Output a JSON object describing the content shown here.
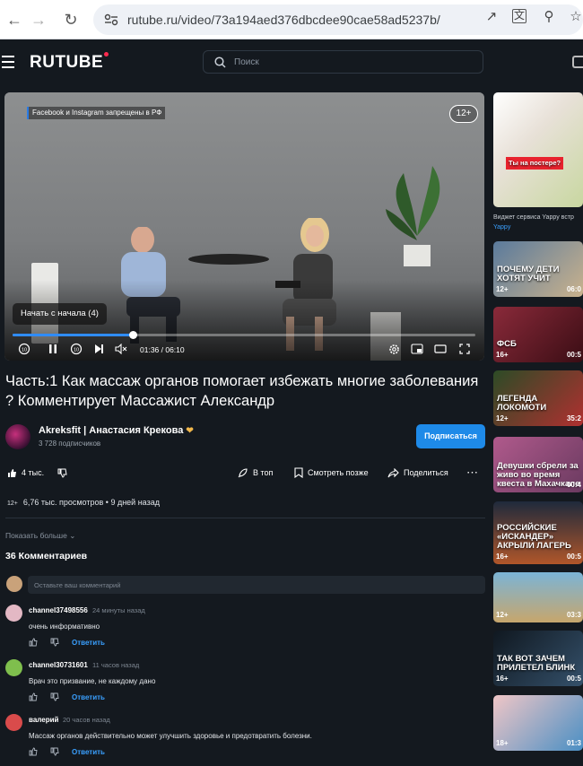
{
  "browser": {
    "url": "rutube.ru/video/73a194aed376dbcdee90cae58ad5237b/"
  },
  "header": {
    "logo": "RUTUBE",
    "search_placeholder": "Поиск"
  },
  "player": {
    "overlay_badge": "Facebook и Instagram запрещены в РФ",
    "age_rating": "12+",
    "resume_label": "Начать с начала (4)",
    "time_current": "01:36",
    "time_total": "06:10",
    "time_display": "01:36 / 06:10",
    "progress": 0.26,
    "skip_back_label": "10",
    "skip_forward_label": "10"
  },
  "video": {
    "title": "Часть:1 Как массаж органов помогает избежать многие заболевания ? Комментирует Массажист Александр",
    "channel_name": "Akreksfit | Анастасия Крекова",
    "subscribers": "3 728 подписчиков",
    "subscribe_label": "Подписаться",
    "likes": "4 тыс.",
    "actions": {
      "top": "В топ",
      "watch_later": "Смотреть позже",
      "share": "Поделиться"
    },
    "meta_age": "12+",
    "views": "6,76 тыс. просмотров",
    "published": "9 дней назад",
    "show_more": "Показать больше"
  },
  "comments": {
    "count_label": "36 Комментариев",
    "input_placeholder": "Оставьте ваш комментарий",
    "reply_label": "Ответить",
    "items": [
      {
        "user": "channel37498556",
        "time": "24 минуты назад",
        "text": "очень информативно",
        "avatar_color": "#e3b8c4"
      },
      {
        "user": "channel30731601",
        "time": "11 часов назад",
        "text": "Врач это призвание, не каждому дано",
        "avatar_color": "#7fbf4d"
      },
      {
        "user": "валерий",
        "time": "20 часов назад",
        "text": "Массаж органов действительно может улучшить здоровье и предотвратить болезни.",
        "avatar_color": "#d94b4b"
      }
    ]
  },
  "sidebar": {
    "widget_caption": "Виджет сервиса Yappy встр",
    "widget_brand": "Yappy",
    "thumbs": [
      {
        "label": "Ты на постере?",
        "age": "",
        "duration": ""
      },
      {
        "label": "ПОЧЕМУ ДЕТИ ХОТЯТ УЧИТ",
        "age": "12+",
        "duration": "06:0"
      },
      {
        "label": "ФСБ",
        "age": "16+",
        "duration": "00:5"
      },
      {
        "label": "ЛЕГЕНДА ЛОКОМОТИ",
        "age": "12+",
        "duration": "35:2"
      },
      {
        "label": "Девушки сбрели за живо во время квеста в Махачкале",
        "age": "",
        "duration": "00:4"
      },
      {
        "label": "РОССИЙСКИЕ «ИСКАНДЕР» АКРЫЛИ ЛАГЕРЬ",
        "age": "16+",
        "duration": "00:5"
      },
      {
        "label": "",
        "age": "12+",
        "duration": "03:3"
      },
      {
        "label": "ТАК ВОТ ЗАЧЕМ ПРИЛЕТЕЛ БЛИНК",
        "age": "16+",
        "duration": "00:5"
      },
      {
        "label": "",
        "age": "18+",
        "duration": "01:3"
      }
    ]
  }
}
